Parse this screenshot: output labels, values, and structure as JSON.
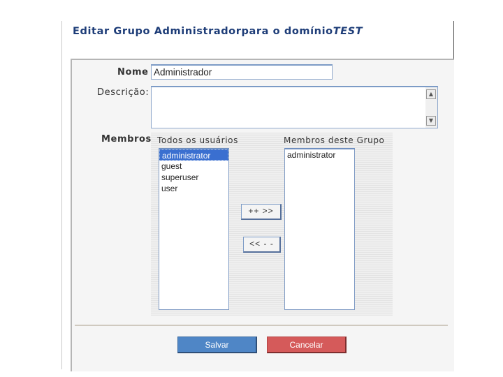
{
  "header": {
    "title_main": "Editar Grupo Administradorpara o domínio",
    "title_domain": "TEST"
  },
  "form": {
    "name_label": "Nome",
    "name_value": "Administrador",
    "description_label": "Descrição:",
    "description_value": "",
    "members_label": "Membros"
  },
  "members": {
    "all_users_label": "Todos os usuários",
    "group_members_label": "Membros deste Grupo",
    "all_users": [
      "administrator",
      "guest",
      "superuser",
      "user"
    ],
    "selected_user": "administrator",
    "group_members": [
      "administrator"
    ],
    "add_button": "++ >>",
    "remove_button": "<< - -"
  },
  "actions": {
    "save_label": "Salvar",
    "cancel_label": "Cancelar",
    "save_color": "#4f86c6",
    "cancel_color": "#d55a5a"
  },
  "icons": {
    "scroll_up": "triangle-up-icon",
    "scroll_down": "triangle-down-icon"
  }
}
